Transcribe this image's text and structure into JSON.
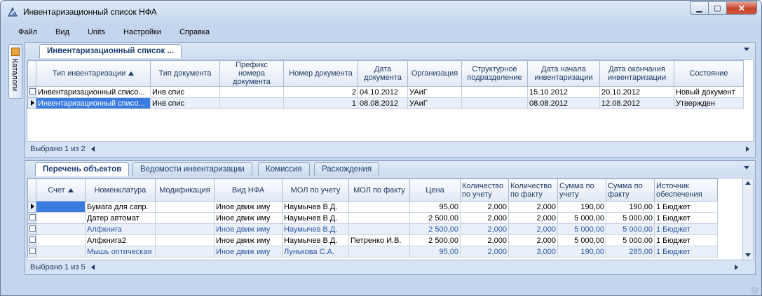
{
  "window": {
    "title": "Инвентаризационный список НФА"
  },
  "menu": [
    "Файл",
    "Вид",
    "Units",
    "Настройки",
    "Справка"
  ],
  "side_tab": {
    "label": "Каталоги"
  },
  "top_panel": {
    "tab": "Инвентаризационный список ...",
    "columns": [
      "Тип инвентаризации",
      "Тип документа",
      "Префикс номера документа",
      "Номер документа",
      "Дата документа",
      "Организация",
      "Структурное подразделение",
      "Дата начала инвентаризации",
      "Дата окончания инвентаризации",
      "Состояние"
    ],
    "rows": [
      [
        "Инвентаризационный списо...",
        "Инв спис",
        "",
        "2",
        "04.10.2012",
        "УАиГ",
        "",
        "15.10.2012",
        "20.10.2012",
        "Новый документ"
      ],
      [
        "Инвентаризационный списо...",
        "Инв спис",
        "",
        "1",
        "08.08.2012",
        "УАиГ",
        "",
        "08.08.2012",
        "12.08.2012",
        "Утвержден"
      ]
    ],
    "status": "Выбрано 1 из 2"
  },
  "bottom_panel": {
    "tabs": [
      "Перечень объектов",
      "Ведомости инвентаризации",
      "Комиссия",
      "Расхождения"
    ],
    "columns": [
      "Счет",
      "Номенклатура",
      "Модификация",
      "Вид НФА",
      "МОЛ по учету",
      "МОЛ по факту",
      "Цена",
      "Количество по учету",
      "Количество по факту",
      "Сумма по учету",
      "Сумма по факту",
      "Источник обеспечения"
    ],
    "rows": [
      [
        "",
        "Бумага  для сапр.",
        "",
        "Иное движ иму",
        "Наумычев В.Д.",
        "",
        "95,00",
        "2,000",
        "2,000",
        "190,00",
        "190,00",
        "1 Бюджет"
      ],
      [
        "",
        "Датер автомат",
        "",
        "Иное движ иму",
        "Наумычев В.Д.",
        "",
        "2 500,00",
        "2,000",
        "2,000",
        "5 000,00",
        "5 000,00",
        "1 Бюджет"
      ],
      [
        "",
        "Алфкнига",
        "",
        "Иное движ иму",
        "Наумычев В.Д.",
        "",
        "2 500,00",
        "2,000",
        "2,000",
        "5 000,00",
        "5 000,00",
        "1 Бюджет"
      ],
      [
        "",
        "Алфкнига2",
        "",
        "Иное движ иму",
        "Наумычев В.Д.",
        "Петренко И.В.",
        "2 500,00",
        "2,000",
        "2,000",
        "5 000,00",
        "5 000,00",
        "1 Бюджет"
      ],
      [
        "",
        "Мышь оптическая",
        "",
        "Иное движ иму",
        "Лунькова С.А.",
        "",
        "95,00",
        "2,000",
        "3,000",
        "190,00",
        "285,00",
        "1 Бюджет"
      ]
    ],
    "status": "Выбрано 1 из 5"
  }
}
